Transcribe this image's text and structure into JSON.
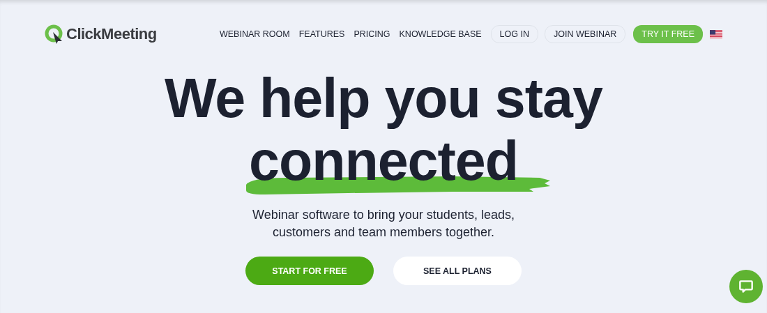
{
  "logo": {
    "text": "ClickMeeting"
  },
  "nav": [
    {
      "label": "WEBINAR ROOM",
      "kind": "link"
    },
    {
      "label": "FEATURES",
      "kind": "link"
    },
    {
      "label": "PRICING",
      "kind": "link"
    },
    {
      "label": "KNOWLEDGE BASE",
      "kind": "link"
    },
    {
      "label": "LOG IN",
      "kind": "outline"
    },
    {
      "label": "JOIN WEBINAR",
      "kind": "outline"
    },
    {
      "label": "TRY IT FREE",
      "kind": "primary"
    }
  ],
  "headline": [
    "We help you stay",
    "connected"
  ],
  "subtitle": [
    "Webinar software to bring your students, leads,",
    "customers and team members together."
  ],
  "buttons": [
    {
      "label": "START FOR FREE",
      "kind": "primary"
    },
    {
      "label": "SEE ALL PLANS",
      "kind": "secondary"
    }
  ]
}
